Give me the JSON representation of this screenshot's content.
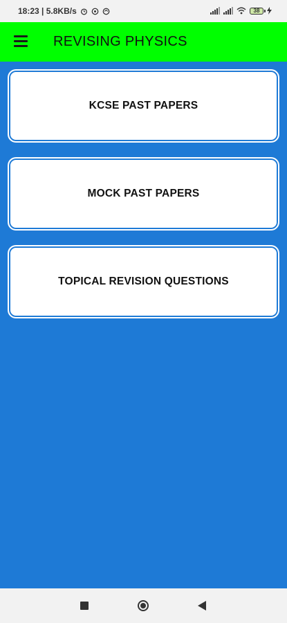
{
  "status_bar": {
    "time_and_speed": "18:23 | 5.8KB/s",
    "icons": [
      "alarm-icon",
      "whatsapp-icon",
      "sync-icon"
    ],
    "right_icons": [
      "signal-icon",
      "signal-icon",
      "wifi-icon",
      "battery-icon",
      "charging-icon"
    ],
    "battery_level": "38"
  },
  "app_bar": {
    "title": "REVISING PHYSICS",
    "menu_icon": "menu-icon",
    "background_color": "#00ff00"
  },
  "menu": {
    "items": [
      {
        "label": "KCSE PAST PAPERS"
      },
      {
        "label": "MOCK PAST PAPERS"
      },
      {
        "label": "TOPICAL REVISION QUESTIONS"
      }
    ]
  },
  "background_color": "#1e7ad6",
  "nav_bar": {
    "icons": [
      "recent-apps-icon",
      "home-icon",
      "back-icon"
    ]
  }
}
